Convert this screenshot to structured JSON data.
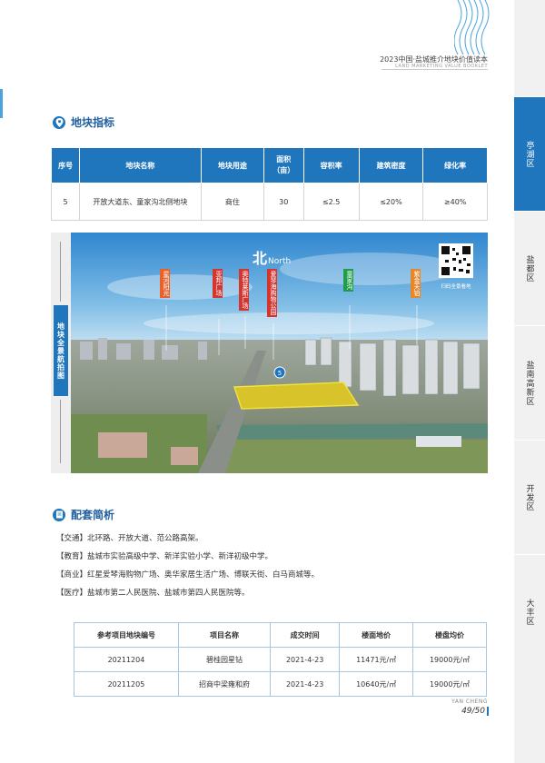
{
  "header": {
    "title": "2023中国·盐城推介地块价值读本",
    "subtitle": "LAND MARKETING VALUE BOOKLET"
  },
  "side_tabs": [
    {
      "label": "亭湖区",
      "active": true
    },
    {
      "label": "盐都区",
      "active": false
    },
    {
      "label": "盐南高新区",
      "active": false
    },
    {
      "label": "开发区",
      "active": false
    },
    {
      "label": "大丰区",
      "active": false
    }
  ],
  "section1": {
    "title": "地块指标",
    "icon": "location-pin-icon",
    "columns": [
      "序号",
      "地块名称",
      "地块用途",
      "面积\n（亩）",
      "容积率",
      "建筑密度",
      "绿化率"
    ],
    "row": [
      "5",
      "开放大道东、童家沟北侧地块",
      "商住",
      "30",
      "≤2.5",
      "≤20%",
      "≥40%"
    ]
  },
  "photo": {
    "side_label": "地块全景航拍图",
    "north_label": "北",
    "north_en": "North",
    "qr_caption": "扫码全景看地",
    "marker": "5",
    "labels": [
      {
        "text": "星河阳光",
        "color": "#e8632a"
      },
      {
        "text": "亚邦广场",
        "color": "#d4362f"
      },
      {
        "text": "奥特莱斯广场",
        "color": "#d4362f"
      },
      {
        "text": "爱琴海购物公园",
        "color": "#d4362f"
      },
      {
        "text": "童家沟",
        "color": "#1f9e48"
      },
      {
        "text": "紫金天铂",
        "color": "#e8862a"
      }
    ]
  },
  "section2": {
    "title": "配套简析",
    "icon": "document-icon",
    "items": [
      "【交通】北环路、开放大道、范公路高架。",
      "【教育】盐城市实验高级中学、新洋实验小学、新洋初级中学。",
      "【商业】红星爱琴海购物广场、奥华家居生活广场、博联天街、白马商城等。",
      "【医疗】盐城市第二人民医院、盐城市第四人民医院等。"
    ],
    "columns": [
      "参考项目地块编号",
      "项目名称",
      "成交时间",
      "楼面地价",
      "楼盘均价"
    ],
    "rows": [
      [
        "20211204",
        "碧桂园星钻",
        "2021-4-23",
        "11471元/㎡",
        "19000元/㎡"
      ],
      [
        "20211205",
        "招商中梁雍和府",
        "2021-4-23",
        "10640元/㎡",
        "19000元/㎡"
      ]
    ]
  },
  "footer": {
    "brand_en": "YAN CHENG",
    "page": "49/50"
  }
}
